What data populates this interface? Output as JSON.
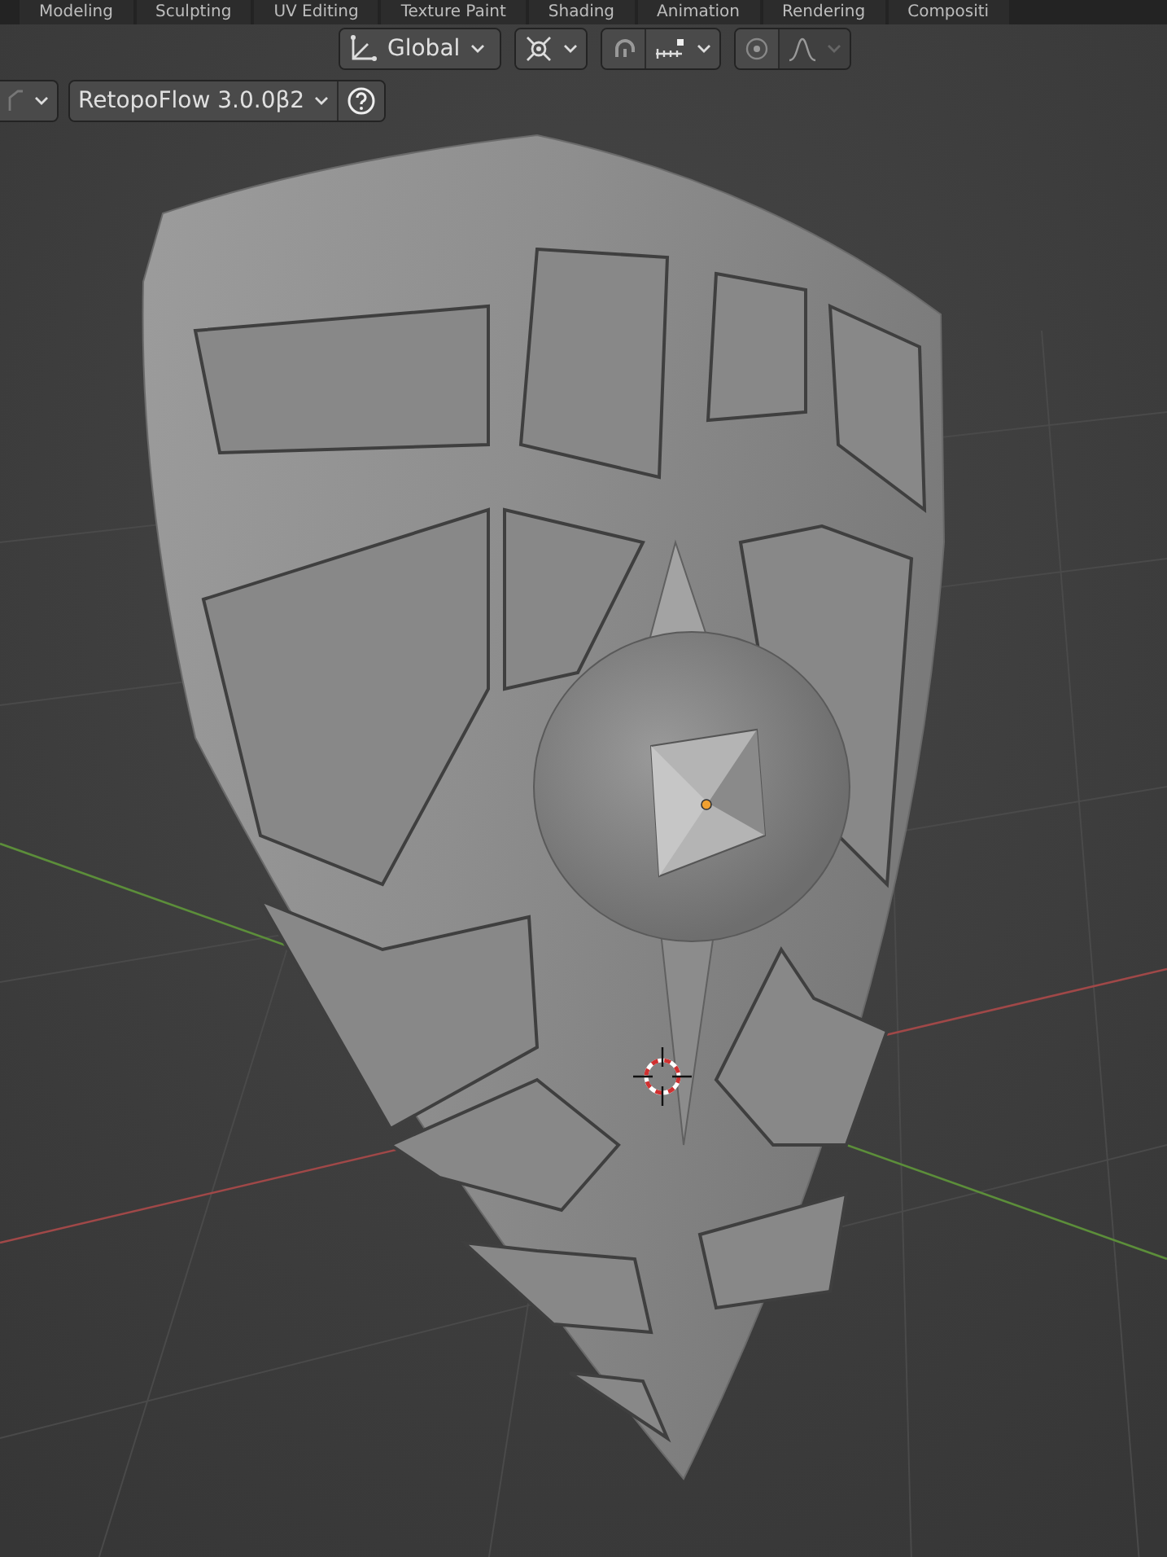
{
  "workspace_tabs": [
    {
      "label": "Modeling"
    },
    {
      "label": "Sculpting"
    },
    {
      "label": "UV Editing"
    },
    {
      "label": "Texture Paint"
    },
    {
      "label": "Shading"
    },
    {
      "label": "Animation"
    },
    {
      "label": "Rendering"
    },
    {
      "label": "Compositi"
    }
  ],
  "header": {
    "transform_orientation": "Global"
  },
  "addon_menu": {
    "label": "RetopoFlow 3.0.0β2"
  }
}
